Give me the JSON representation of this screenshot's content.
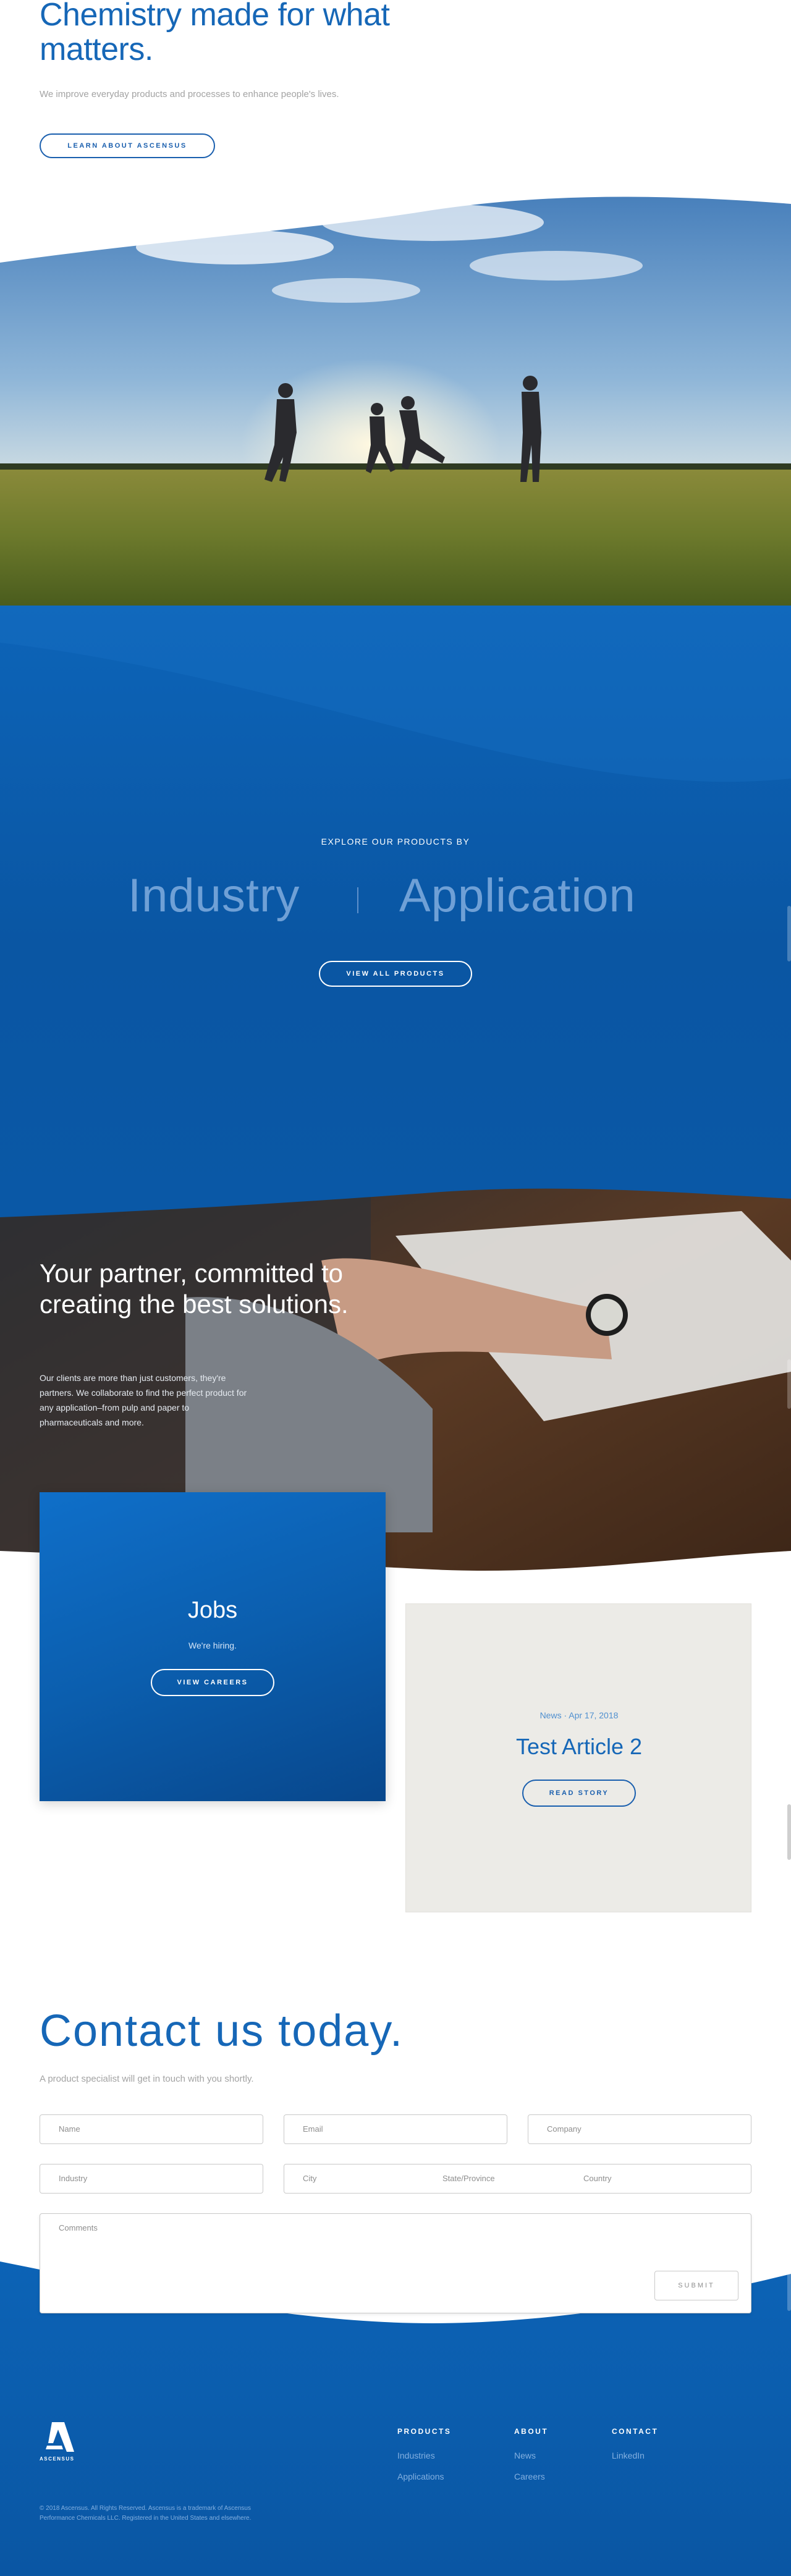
{
  "hero": {
    "title": "Chemistry made for what matters.",
    "subtitle": "We improve everyday products and processes to enhance people's lives.",
    "cta": "LEARN ABOUT ASCENSUS"
  },
  "explore": {
    "label": "EXPLORE OUR PRODUCTS BY",
    "industry": "Industry",
    "application": "Application",
    "cta": "VIEW ALL PRODUCTS"
  },
  "partner": {
    "title": "Your partner, committed to creating the best solutions.",
    "body": "Our clients are more than just customers, they're partners. We collaborate to find the perfect product for any application–from pulp and paper to pharmaceuticals and more."
  },
  "jobs": {
    "title": "Jobs",
    "subtitle": "We're hiring.",
    "cta": "VIEW CAREERS"
  },
  "article": {
    "meta": "News · Apr 17, 2018",
    "title": "Test Article 2",
    "cta": "READ STORY"
  },
  "contact": {
    "title": "Contact us today.",
    "subtitle": "A product specialist will get in touch with you shortly.",
    "fields": {
      "name": "Name",
      "email": "Email",
      "company": "Company",
      "industry": "Industry",
      "city": "City",
      "state": "State/Province",
      "country": "Country",
      "comments": "Comments"
    },
    "submit": "SUBMIT"
  },
  "footer": {
    "logo_text": "ASCENSUS",
    "columns": [
      {
        "heading": "PRODUCTS",
        "links": [
          "Industries",
          "Applications"
        ]
      },
      {
        "heading": "ABOUT",
        "links": [
          "News",
          "Careers"
        ]
      },
      {
        "heading": "CONTACT",
        "links": [
          "LinkedIn"
        ]
      }
    ],
    "legal_1": "© 2018 Ascensus. All Rights Reserved. Ascensus is a trademark of Ascensus",
    "legal_2": "Performance Chemicals LLC. Registered in the United States and elsewhere."
  },
  "colors": {
    "brand_blue": "#1667b7",
    "deep_blue": "#0a56a3",
    "link_blue": "#82afe0"
  }
}
